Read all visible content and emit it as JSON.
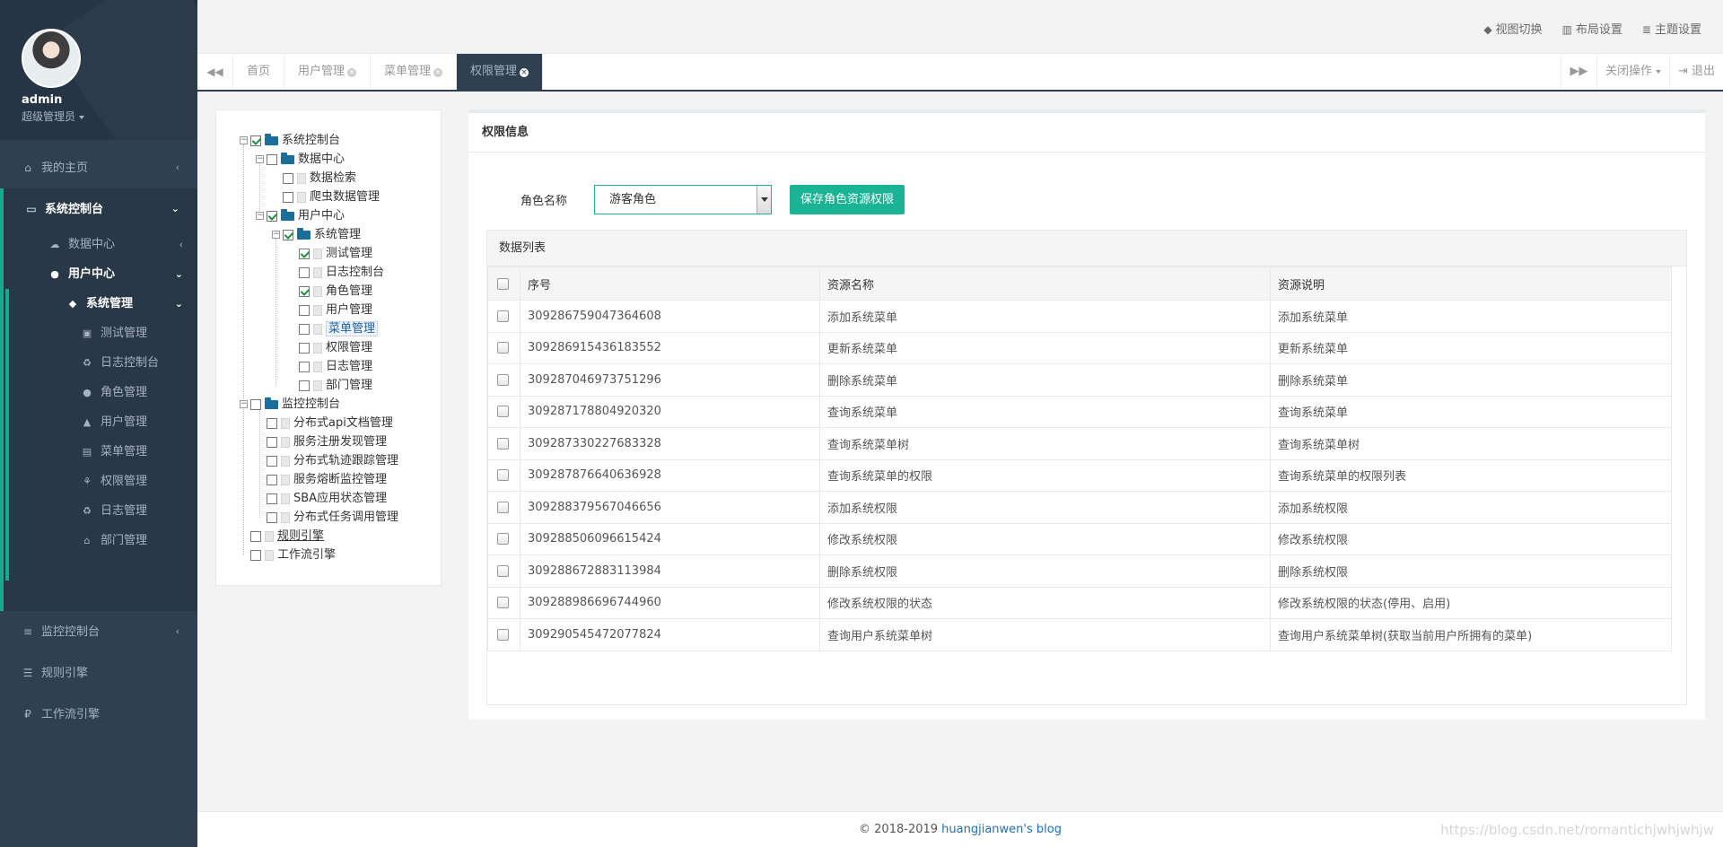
{
  "sidebar": {
    "user": {
      "name": "admin",
      "role": "超级管理员"
    },
    "nav": {
      "home": "我的主页",
      "system": "系统控制台",
      "data_center": "数据中心",
      "user_center": "用户中心",
      "system_mgmt": "系统管理",
      "sub_items": [
        "测试管理",
        "日志控制台",
        "角色管理",
        "用户管理",
        "菜单管理",
        "权限管理",
        "日志管理",
        "部门管理"
      ],
      "monitor": "监控控制台",
      "rules": "规则引擎",
      "workflow": "工作流引擎"
    }
  },
  "topbar": {
    "view_switch": "视图切换",
    "layout_settings": "布局设置",
    "theme_settings": "主题设置"
  },
  "tabs": {
    "items": [
      "首页",
      "用户管理",
      "菜单管理",
      "权限管理"
    ],
    "active": "权限管理",
    "close_ops": "关闭操作",
    "logout": "退出"
  },
  "tree": {
    "nodes": [
      {
        "label": "系统控制台",
        "checked": true
      },
      {
        "label": "数据中心",
        "checked": false
      },
      {
        "label": "数据检索",
        "checked": false
      },
      {
        "label": "爬虫数据管理",
        "checked": false
      },
      {
        "label": "用户中心",
        "checked": true
      },
      {
        "label": "系统管理",
        "checked": true
      },
      {
        "label": "测试管理",
        "checked": true
      },
      {
        "label": "日志控制台",
        "checked": false
      },
      {
        "label": "角色管理",
        "checked": true
      },
      {
        "label": "用户管理",
        "checked": false
      },
      {
        "label": "菜单管理",
        "checked": false
      },
      {
        "label": "权限管理",
        "checked": false
      },
      {
        "label": "日志管理",
        "checked": false
      },
      {
        "label": "部门管理",
        "checked": false
      },
      {
        "label": "监控控制台",
        "checked": false
      },
      {
        "label": "分布式api文档管理",
        "checked": false
      },
      {
        "label": "服务注册发现管理",
        "checked": false
      },
      {
        "label": "分布式轨迹跟踪管理",
        "checked": false
      },
      {
        "label": "服务熔断监控管理",
        "checked": false
      },
      {
        "label": "SBA应用状态管理",
        "checked": false
      },
      {
        "label": "分布式任务调用管理",
        "checked": false
      },
      {
        "label": "规则引擎",
        "checked": false
      },
      {
        "label": "工作流引擎",
        "checked": false
      }
    ]
  },
  "main": {
    "title": "权限信息",
    "role_label": "角色名称",
    "role_value": "游客角色",
    "save_label": "保存角色资源权限",
    "list_title": "数据列表",
    "columns": [
      "序号",
      "资源名称",
      "资源说明"
    ],
    "rows": [
      [
        "309286759047364608",
        "添加系统菜单",
        "添加系统菜单"
      ],
      [
        "309286915436183552",
        "更新系统菜单",
        "更新系统菜单"
      ],
      [
        "309287046973751296",
        "删除系统菜单",
        "删除系统菜单"
      ],
      [
        "309287178804920320",
        "查询系统菜单",
        "查询系统菜单"
      ],
      [
        "309287330227683328",
        "查询系统菜单树",
        "查询系统菜单树"
      ],
      [
        "309287876640636928",
        "查询系统菜单的权限",
        "查询系统菜单的权限列表"
      ],
      [
        "309288379567046656",
        "添加系统权限",
        "添加系统权限"
      ],
      [
        "309288506096615424",
        "修改系统权限",
        "修改系统权限"
      ],
      [
        "309288672883113984",
        "删除系统权限",
        "删除系统权限"
      ],
      [
        "309288986696744960",
        "修改系统权限的状态",
        "修改系统权限的状态(停用、启用)"
      ],
      [
        "309290545472077824",
        "查询用户系统菜单树",
        "查询用户系统菜单树(获取当前用户所拥有的菜单)"
      ]
    ]
  },
  "footer": {
    "copyright": "© 2018-2019 ",
    "brand": "huangjianwen's blog",
    "watermark": "https://blog.csdn.net/romantichjwhjwhjw"
  },
  "colors": {
    "sidebar": "#2f4050",
    "accent": "#1ab394"
  }
}
